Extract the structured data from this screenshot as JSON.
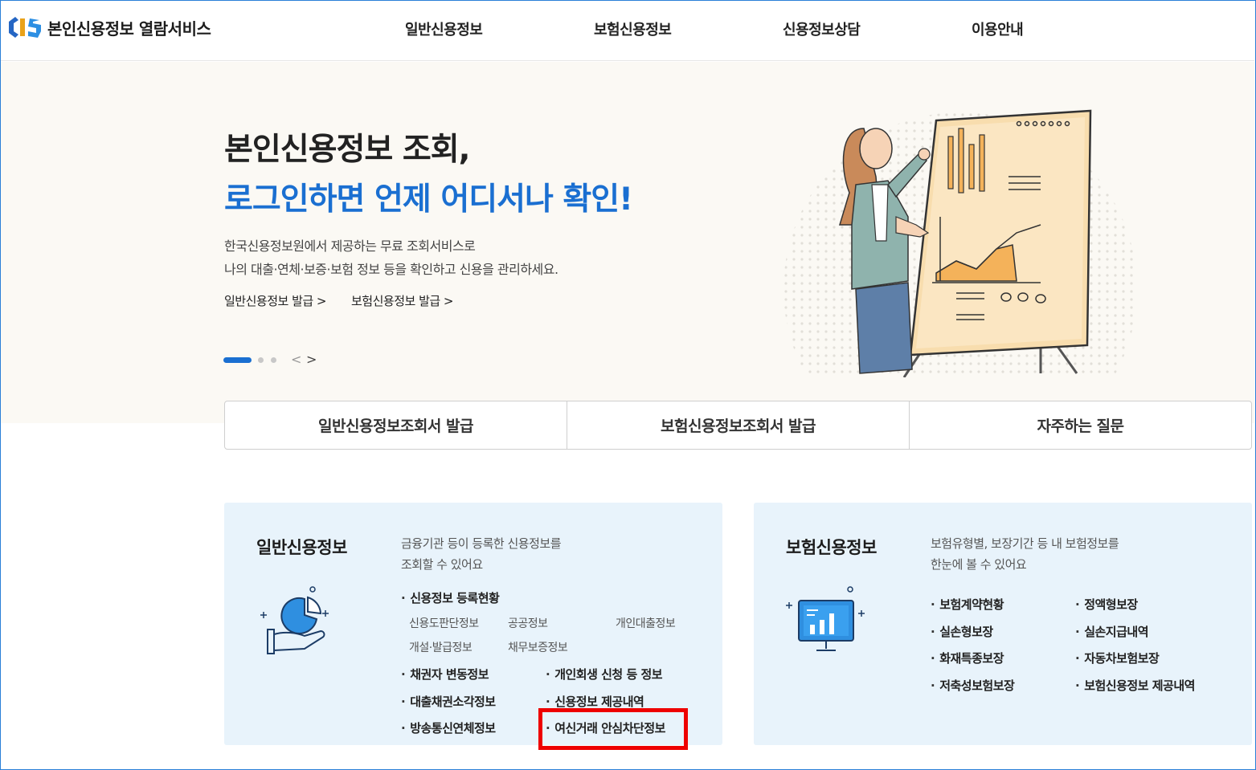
{
  "header": {
    "logo_alt": "CIS",
    "site_title": "본인신용정보 열람서비스",
    "nav": [
      "일반신용정보",
      "보험신용정보",
      "신용정보상담",
      "이용안내"
    ]
  },
  "hero": {
    "title_line1": "본인신용정보 조회,",
    "title_line2": "로그인하면 언제 어디서나 확인!",
    "desc_line1": "한국신용정보원에서 제공하는 무료 조회서비스로",
    "desc_line2": "나의 대출·연체·보증·보험 정보 등을 확인하고 신용을 관리하세요.",
    "link_general": "일반신용정보 발급 >",
    "link_insurance": "보험신용정보 발급 >",
    "prev": "<",
    "next": ">"
  },
  "quick": [
    "일반신용정보조회서 발급",
    "보험신용정보조회서 발급",
    "자주하는 질문"
  ],
  "general_card": {
    "title": "일반신용정보",
    "desc_line1": "금융기관 등이 등록한 신용정보를",
    "desc_line2": "조회할 수 있어요",
    "group_title": "신용정보 등록현황",
    "sub_items": [
      "신용도판단정보",
      "공공정보",
      "개인대출정보",
      "개설·발급정보",
      "채무보증정보"
    ],
    "items": [
      "채권자 변동정보",
      "개인회생 신청 등 정보",
      "대출채권소각정보",
      "신용정보 제공내역",
      "방송통신연체정보",
      "여신거래 안심차단정보"
    ]
  },
  "insurance_card": {
    "title": "보험신용정보",
    "desc_line1": "보험유형별, 보장기간 등 내 보험정보를",
    "desc_line2": "한눈에 볼 수 있어요",
    "items": [
      "보험계약현황",
      "정액형보장",
      "실손형보장",
      "실손지급내역",
      "화재특종보장",
      "자동차보험보장",
      "저축성보험보장",
      "보험신용정보 제공내역"
    ]
  },
  "colors": {
    "brand_blue": "#1a6fd1",
    "hero_bg": "#fbf9f4",
    "card_bg": "#e8f3fb",
    "highlight": "#ee0000"
  },
  "icons": [
    "cis-logo-icon",
    "hand-pie-chart-icon",
    "monitor-chart-icon"
  ]
}
